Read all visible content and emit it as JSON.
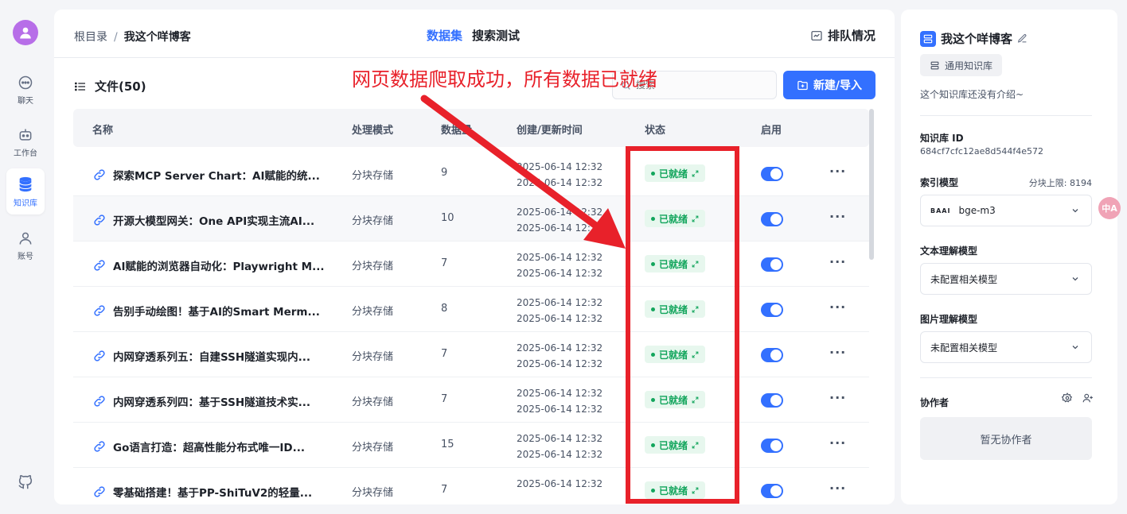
{
  "nav": {
    "items": [
      {
        "label": "聊天",
        "icon": "chat-icon"
      },
      {
        "label": "工作台",
        "icon": "robot-icon"
      },
      {
        "label": "知识库",
        "icon": "database-icon",
        "active": true
      },
      {
        "label": "账号",
        "icon": "user-icon"
      }
    ]
  },
  "header": {
    "breadcrumb_root": "根目录",
    "breadcrumb_sep": "/",
    "breadcrumb_current": "我这个咩博客",
    "tabs": [
      {
        "label": "数据集",
        "active": true
      },
      {
        "label": "搜索测试"
      }
    ],
    "queue_label": "排队情况"
  },
  "files": {
    "title": "文件(50)",
    "search_placeholder": "搜索",
    "new_button": "新建/导入",
    "columns": [
      "名称",
      "处理模式",
      "数据量",
      "创建/更新时间",
      "状态",
      "启用"
    ],
    "rows": [
      {
        "name": "探索MCP Server Chart：AI赋能的统...",
        "mode": "分块存储",
        "count": "9",
        "created": "2025-06-14 12:32",
        "updated": "2025-06-14 12:32",
        "status": "已就绪"
      },
      {
        "name": "开源大模型网关：One API实现主流AI...",
        "mode": "分块存储",
        "count": "10",
        "created": "2025-06-14 12:32",
        "updated": "2025-06-14 12:32",
        "status": "已就绪"
      },
      {
        "name": "AI赋能的浏览器自动化：Playwright M...",
        "mode": "分块存储",
        "count": "7",
        "created": "2025-06-14 12:32",
        "updated": "2025-06-14 12:32",
        "status": "已就绪"
      },
      {
        "name": "告别手动绘图！基于AI的Smart Merm...",
        "mode": "分块存储",
        "count": "8",
        "created": "2025-06-14 12:32",
        "updated": "2025-06-14 12:32",
        "status": "已就绪"
      },
      {
        "name": "内网穿透系列五：自建SSH隧道实现内...",
        "mode": "分块存储",
        "count": "7",
        "created": "2025-06-14 12:32",
        "updated": "2025-06-14 12:32",
        "status": "已就绪"
      },
      {
        "name": "内网穿透系列四：基于SSH隧道技术实...",
        "mode": "分块存储",
        "count": "7",
        "created": "2025-06-14 12:32",
        "updated": "2025-06-14 12:32",
        "status": "已就绪"
      },
      {
        "name": "Go语言打造：超高性能分布式唯一ID...",
        "mode": "分块存储",
        "count": "15",
        "created": "2025-06-14 12:32",
        "updated": "2025-06-14 12:32",
        "status": "已就绪"
      },
      {
        "name": "零基础搭建！基于PP-ShiTuV2的轻量...",
        "mode": "分块存储",
        "count": "7",
        "created": "2025-06-14 12:32",
        "updated": "",
        "status": "已就绪"
      }
    ]
  },
  "side": {
    "title": "我这个咩博客",
    "type": "通用知识库",
    "intro": "这个知识库还没有介绍~",
    "id_label": "知识库 ID",
    "id_value": "684cf7cfc12ae8d544f4e572",
    "index_label": "索引模型",
    "chunk_limit": "分块上限: 8194",
    "index_model_brand": "BAAI",
    "index_model": "bge-m3",
    "text_model_label": "文本理解模型",
    "text_model": "未配置相关模型",
    "image_model_label": "图片理解模型",
    "image_model": "未配置相关模型",
    "collab_label": "协作者",
    "collab_empty": "暂无协作者"
  },
  "floating": {
    "translate": "中A"
  },
  "annotation": {
    "text": "网页数据爬取成功，所有数据已就绪",
    "color": "#e8212a"
  },
  "colors": {
    "primary": "#3370ff",
    "success": "#12a55c",
    "annotation": "#e8212a"
  }
}
